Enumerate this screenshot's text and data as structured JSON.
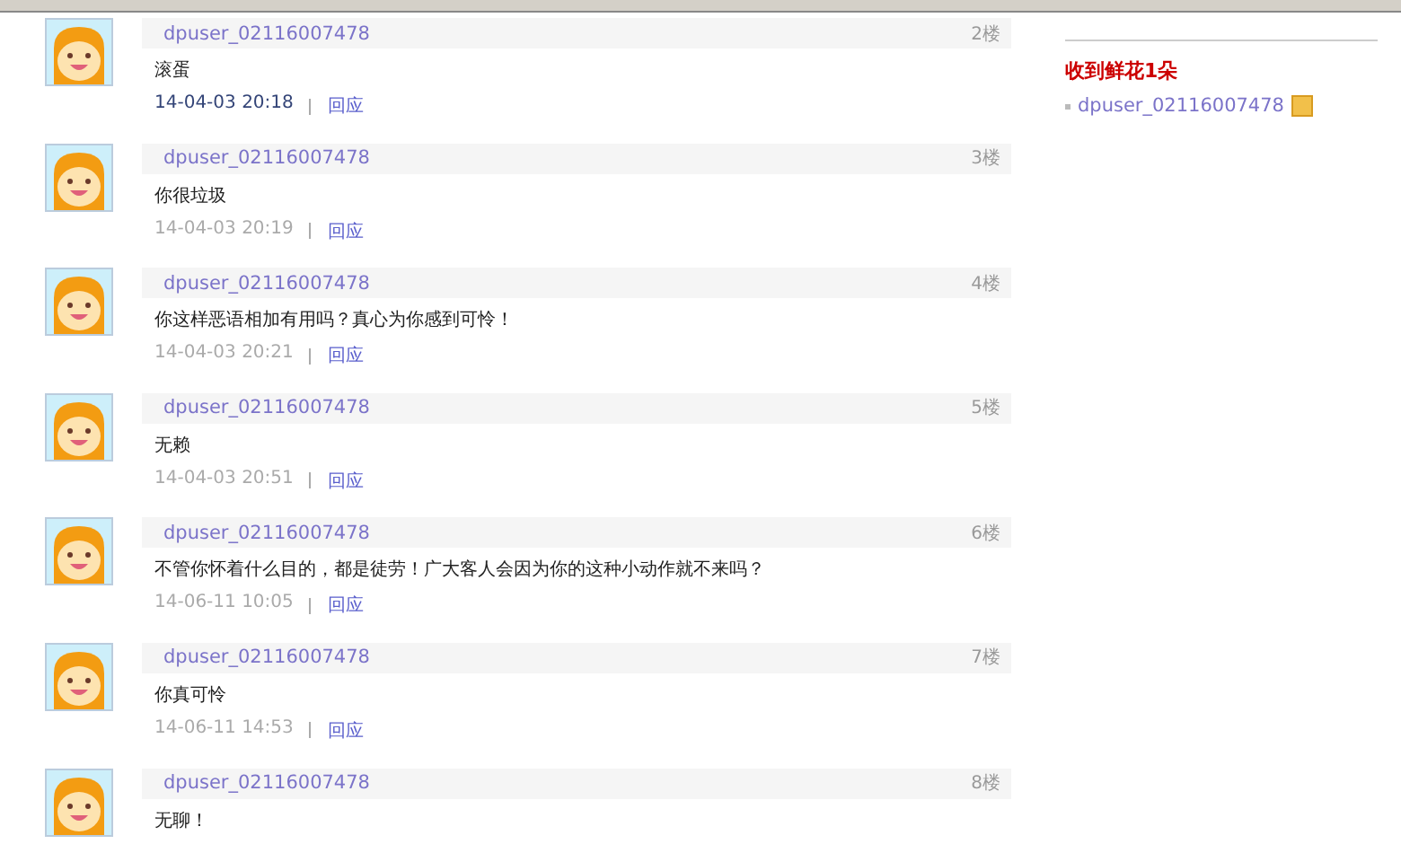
{
  "posts": [
    {
      "user": "dpuser_02116007478",
      "floor": "2楼",
      "content": "滚蛋",
      "time": "14-04-03 20:18",
      "reply": "回应",
      "highlighted": true
    },
    {
      "user": "dpuser_02116007478",
      "floor": "3楼",
      "content": "你很垃圾",
      "time": "14-04-03 20:19",
      "reply": "回应",
      "highlighted": false
    },
    {
      "user": "dpuser_02116007478",
      "floor": "4楼",
      "content": "你这样恶语相加有用吗？真心为你感到可怜！",
      "time": "14-04-03 20:21",
      "reply": "回应",
      "highlighted": false
    },
    {
      "user": "dpuser_02116007478",
      "floor": "5楼",
      "content": "无赖",
      "time": "14-04-03 20:51",
      "reply": "回应",
      "highlighted": false
    },
    {
      "user": "dpuser_02116007478",
      "floor": "6楼",
      "content": "不管你怀着什么目的，都是徒劳！广大客人会因为你的这种小动作就不来吗？",
      "time": "14-06-11 10:05",
      "reply": "回应",
      "highlighted": false
    },
    {
      "user": "dpuser_02116007478",
      "floor": "7楼",
      "content": "你真可怜",
      "time": "14-06-11 14:53",
      "reply": "回应",
      "highlighted": false
    },
    {
      "user": "dpuser_02116007478",
      "floor": "8楼",
      "content": "无聊！"
    }
  ],
  "sidebar": {
    "title": "收到鲜花1朵",
    "items": [
      {
        "user": "dpuser_02116007478"
      }
    ]
  }
}
